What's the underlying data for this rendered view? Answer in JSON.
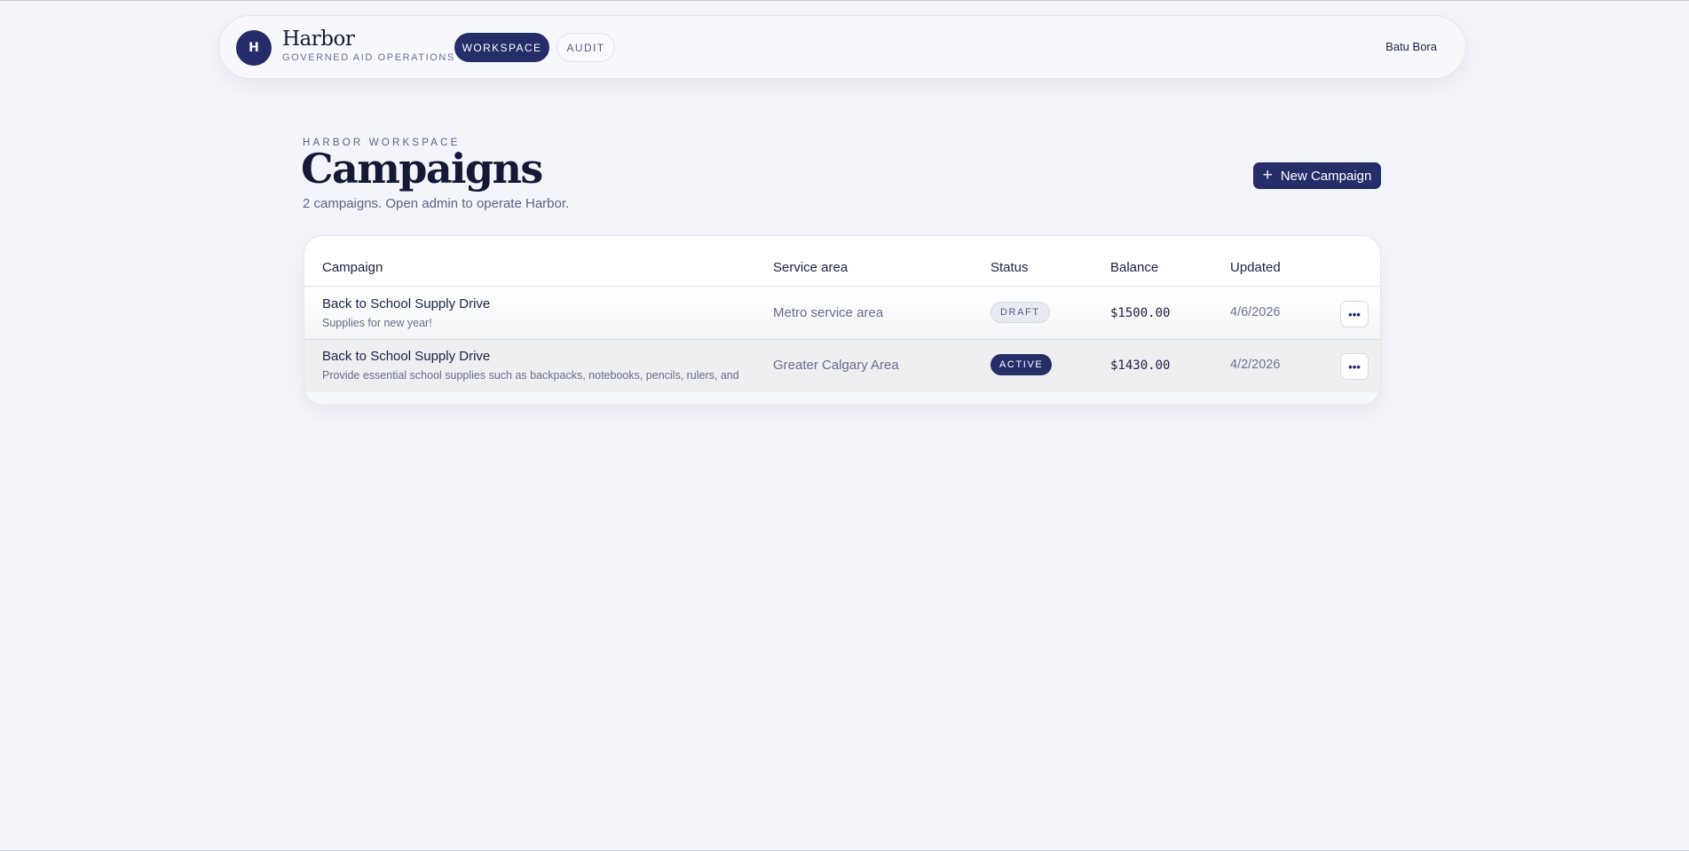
{
  "header": {
    "logo_letter": "H",
    "brand_name": "Harbor",
    "brand_subtitle": "GOVERNED AID OPERATIONS",
    "nav": [
      {
        "label": "WORKSPACE",
        "active": true
      },
      {
        "label": "AUDIT",
        "active": false
      }
    ],
    "user_name": "Batu Bora"
  },
  "page": {
    "eyebrow": "HARBOR WORKSPACE",
    "title": "Campaigns",
    "subtitle": "2 campaigns. Open admin to operate Harbor.",
    "new_button": {
      "icon": "+",
      "label": "New Campaign"
    }
  },
  "table": {
    "columns": [
      "Campaign",
      "Service area",
      "Status",
      "Balance",
      "Updated"
    ],
    "rows": [
      {
        "title": "Back to School Supply Drive",
        "description": "Supplies for new year!",
        "service_area": "Metro service area",
        "status": "DRAFT",
        "balance": "$1500.00",
        "updated": "4/6/2026",
        "more": "•••"
      },
      {
        "title": "Back to School Supply Drive",
        "description": "Provide essential school supplies such as backpacks, notebooks, pencils, rulers, and…",
        "service_area": "Greater Calgary Area",
        "status": "ACTIVE",
        "balance": "$1430.00",
        "updated": "4/2/2026",
        "more": "•••"
      }
    ]
  },
  "colors": {
    "accent": "#262e6a",
    "background": "#f3f5fa"
  }
}
